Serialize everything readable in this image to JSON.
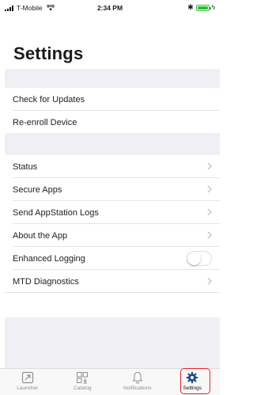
{
  "status_bar": {
    "carrier": "T-Mobile",
    "time": "2:34 PM",
    "battery_level": 1.0,
    "icons": [
      "signal-icon",
      "wifi-icon",
      "bluetooth-icon",
      "battery-icon",
      "charging-icon"
    ]
  },
  "page": {
    "title": "Settings"
  },
  "section1": {
    "items": [
      {
        "label": "Check for Updates"
      },
      {
        "label": "Re-enroll Device"
      }
    ]
  },
  "section2": {
    "items": [
      {
        "label": "Status",
        "accessory": "chevron"
      },
      {
        "label": "Secure Apps",
        "accessory": "chevron"
      },
      {
        "label": "Send AppStation Logs",
        "accessory": "chevron"
      },
      {
        "label": "About the App",
        "accessory": "chevron"
      },
      {
        "label": "Enhanced Logging",
        "accessory": "toggle",
        "toggle_on": false
      },
      {
        "label": "MTD Diagnostics",
        "accessory": "chevron"
      }
    ]
  },
  "tab_bar": {
    "tabs": [
      {
        "label": "Launcher",
        "icon": "launcher-icon"
      },
      {
        "label": "Catalog",
        "icon": "catalog-icon"
      },
      {
        "label": "Notifications",
        "icon": "bell-icon"
      },
      {
        "label": "Settings",
        "icon": "gear-icon",
        "active": true
      }
    ]
  },
  "colors": {
    "background": "#ffffff",
    "group_background": "#efeff4",
    "battery": "#2bbf3a",
    "highlight_outline": "#ee2222",
    "inactive_tab": "#8e8e93"
  }
}
